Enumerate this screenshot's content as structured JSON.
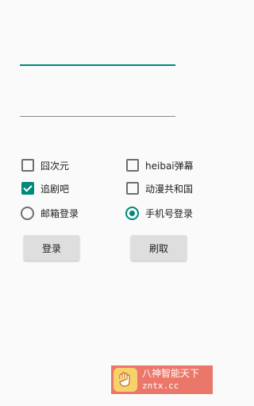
{
  "form": {
    "field_1_value": "",
    "field_2_value": ""
  },
  "options": {
    "checkbox_1": {
      "label": "囧次元",
      "checked": false
    },
    "checkbox_2": {
      "label": "heibai弹幕",
      "checked": false
    },
    "checkbox_3": {
      "label": "追剧吧",
      "checked": true
    },
    "checkbox_4": {
      "label": "动漫共和国",
      "checked": false
    },
    "radio_1": {
      "label": "邮箱登录",
      "checked": false
    },
    "radio_2": {
      "label": "手机号登录",
      "checked": true
    }
  },
  "buttons": {
    "login_label": "登录",
    "cancel_label": "刷取"
  },
  "watermark": {
    "line1": "八神智能天下",
    "line2": "zntx.cc"
  },
  "colors": {
    "accent": "#00897b",
    "watermark_bg": "#e85f50"
  }
}
